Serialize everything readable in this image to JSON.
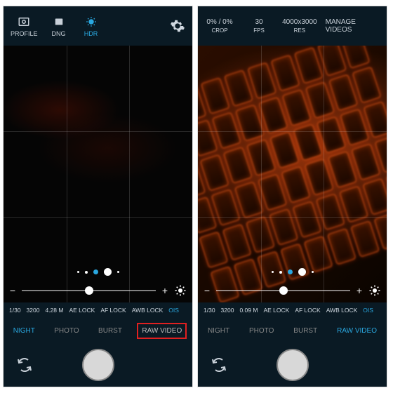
{
  "left": {
    "topbar": {
      "profile": "PROFILE",
      "dng": "DNG",
      "hdr": "HDR"
    },
    "dots_active_index": 1,
    "slider_pos_pct": 50,
    "info": {
      "shutter": "1/30",
      "iso": "3200",
      "focus": "4.28 M",
      "ae": "AE LOCK",
      "af": "AF LOCK",
      "awb": "AWB LOCK",
      "ois": "OIS"
    },
    "modes": {
      "night": "NIGHT",
      "photo": "PHOTO",
      "burst": "BURST",
      "rawvideo": "RAW VIDEO"
    }
  },
  "right": {
    "topbar": {
      "crop_val": "0% / 0%",
      "crop_lbl": "CROP",
      "fps_val": "30",
      "fps_lbl": "FPS",
      "res_val": "4000x3000",
      "res_lbl": "RES",
      "manage": "MANAGE VIDEOS"
    },
    "dots_active_index": 1,
    "slider_pos_pct": 50,
    "info": {
      "shutter": "1/30",
      "iso": "3200",
      "focus": "0.09 M",
      "ae": "AE LOCK",
      "af": "AF LOCK",
      "awb": "AWB LOCK",
      "ois": "OIS"
    },
    "modes": {
      "night": "NIGHT",
      "photo": "PHOTO",
      "burst": "BURST",
      "rawvideo": "RAW VIDEO"
    }
  }
}
